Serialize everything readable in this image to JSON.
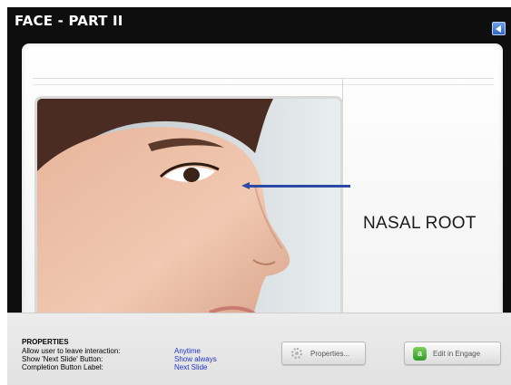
{
  "slide": {
    "title": "FACE - PART II",
    "label": "NASAL ROOT"
  },
  "icons": {
    "back": "back-arrow-icon",
    "properties": "gear-icon",
    "engage": "engage-logo-icon"
  },
  "colors": {
    "frame": "#0e0e0e",
    "pointer": "#2b4aa5",
    "value_text": "#2233cc",
    "nav_button": "#2e66c4",
    "engage_logo": "#2f9a2a"
  },
  "properties": {
    "heading": "PROPERTIES",
    "rows": [
      {
        "label": "Allow user to leave interaction:",
        "value": "Anytime"
      },
      {
        "label": "Show 'Next Slide' Button:",
        "value": "Show always"
      },
      {
        "label": "Completion Button Label:",
        "value": "Next Slide"
      }
    ],
    "properties_button": "Properties...",
    "engage_button": "Edit in Engage",
    "engage_logo_letter": "a"
  }
}
